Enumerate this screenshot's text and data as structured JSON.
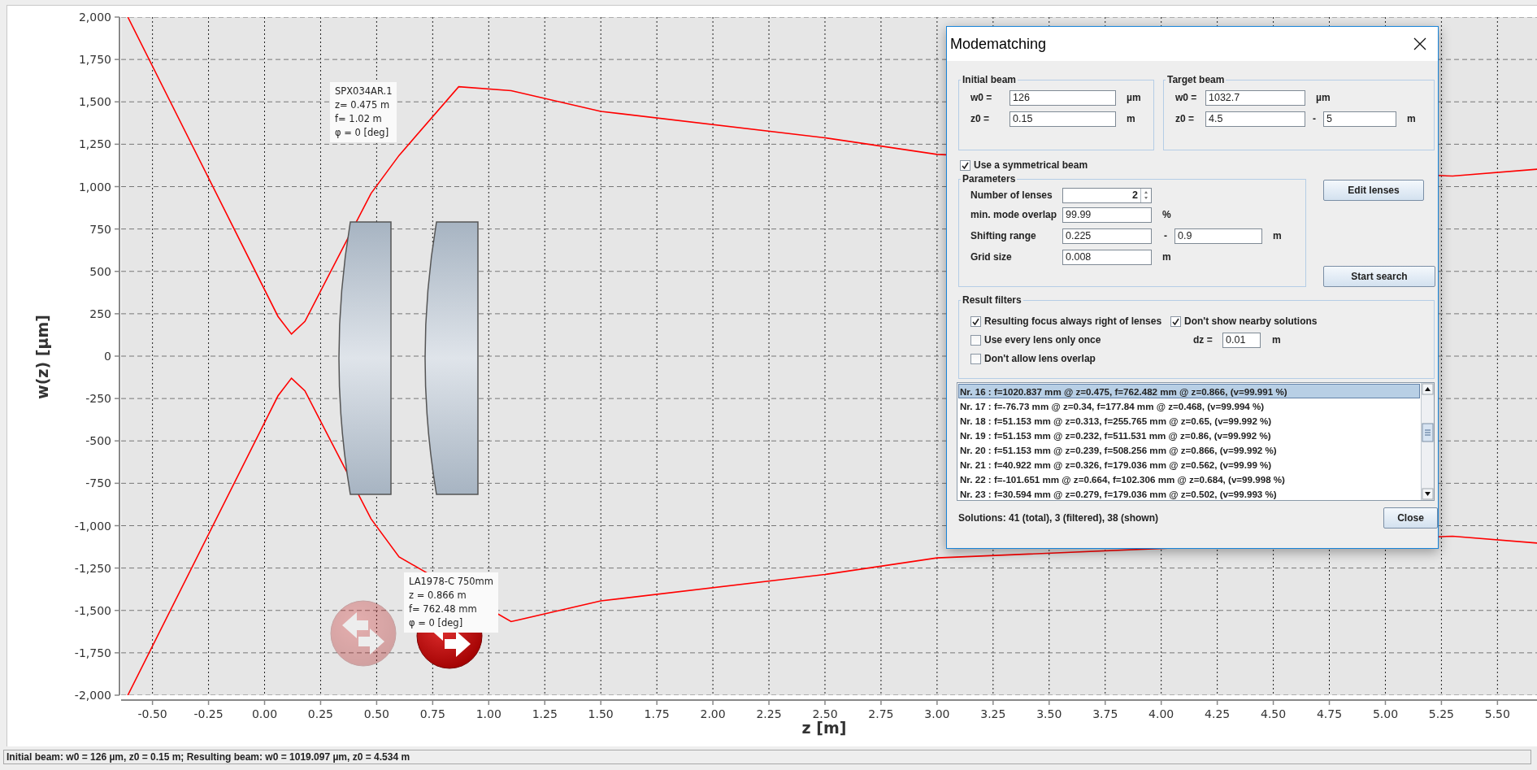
{
  "chart": {
    "chart_data": {
      "type": "line",
      "xlabel": "z [m]",
      "ylabel": "w(z) [µm]",
      "x": [
        -0.61,
        0.06,
        0.12,
        0.18,
        0.475,
        0.6,
        0.866,
        1.1,
        1.5,
        2.5,
        3.0,
        5.3,
        5.68
      ],
      "series": [
        {
          "color": "#ff0000",
          "values": [
            2000,
            234,
            130,
            205,
            960,
            1184,
            1589,
            1566,
            1444,
            1288,
            1190,
            1062,
            1103
          ]
        },
        {
          "color": "#ff0000",
          "values": [
            -2000,
            -234,
            -130,
            -205,
            -960,
            -1184,
            null,
            -1566,
            -1444,
            -1288,
            -1190,
            -1062,
            -1103
          ]
        }
      ],
      "grid": true,
      "xlim": [
        -0.64,
        5.68
      ],
      "ylim": [
        -2000,
        2000
      ],
      "xticks": [
        {
          "value": -0.5,
          "label": "-0.50"
        },
        {
          "value": -0.25,
          "label": "-0.25"
        },
        {
          "value": 0,
          "label": "0.00"
        },
        {
          "value": 0.25,
          "label": "0.25"
        },
        {
          "value": 0.5,
          "label": "0.50"
        },
        {
          "value": 0.75,
          "label": "0.75"
        },
        {
          "value": 1,
          "label": "1.00"
        },
        {
          "value": 1.25,
          "label": "1.25"
        },
        {
          "value": 1.5,
          "label": "1.50"
        },
        {
          "value": 1.75,
          "label": "1.75"
        },
        {
          "value": 2,
          "label": "2.00"
        },
        {
          "value": 2.25,
          "label": "2.25"
        },
        {
          "value": 2.5,
          "label": "2.50"
        },
        {
          "value": 2.75,
          "label": "2.75"
        },
        {
          "value": 3,
          "label": "3.00"
        },
        {
          "value": 3.25,
          "label": "3.25"
        },
        {
          "value": 3.5,
          "label": "3.50"
        },
        {
          "value": 3.75,
          "label": "3.75"
        },
        {
          "value": 4,
          "label": "4.00"
        },
        {
          "value": 4.25,
          "label": "4.25"
        },
        {
          "value": 4.5,
          "label": "4.50"
        },
        {
          "value": 4.75,
          "label": "4.75"
        },
        {
          "value": 5,
          "label": "5.00"
        },
        {
          "value": 5.25,
          "label": "5.25"
        },
        {
          "value": 5.5,
          "label": "5.50"
        }
      ],
      "yticks": [
        {
          "value": 2000,
          "label": "2,000"
        },
        {
          "value": 1750,
          "label": "1,750"
        },
        {
          "value": 1500,
          "label": "1,500"
        },
        {
          "value": 1250,
          "label": "1,250"
        },
        {
          "value": 1000,
          "label": "1,000"
        },
        {
          "value": 750,
          "label": "750"
        },
        {
          "value": 500,
          "label": "500"
        },
        {
          "value": 250,
          "label": "250"
        },
        {
          "value": 0,
          "label": "0"
        },
        {
          "value": -250,
          "label": "-250"
        },
        {
          "value": -500,
          "label": "-500"
        },
        {
          "value": -750,
          "label": "-750"
        },
        {
          "value": -1000,
          "label": "-1,000"
        },
        {
          "value": -1250,
          "label": "-1,250"
        },
        {
          "value": -1500,
          "label": "-1,500"
        },
        {
          "value": -1750,
          "label": "-1,750"
        },
        {
          "value": -2000,
          "label": "-2,000"
        }
      ]
    },
    "lenses": [
      {
        "lines": [
          "SPX034AR.1",
          "z= 0.475 m",
          "f= 1.02 m",
          "φ = 0 [deg]"
        ]
      },
      {
        "lines": [
          "LA1978-C 750mm",
          "z = 0.866 m",
          "f= 762.48 mm",
          "φ = 0 [deg]"
        ]
      }
    ],
    "shift_buttons": [
      {
        "disabled": true
      },
      {
        "disabled": false
      }
    ]
  },
  "dialog": {
    "title": "Modematching",
    "initial_beam": {
      "title": "Initial beam",
      "rows": [
        {
          "label": "w0 =",
          "value": "126",
          "unit": "µm"
        },
        {
          "label": "z0 =",
          "value": "0.15",
          "unit": "m"
        }
      ]
    },
    "target_beam": {
      "title": "Target beam",
      "rows": [
        {
          "label": "w0 =",
          "value": "1032.7",
          "unit": "µm"
        },
        {
          "label": "z0 =",
          "value": "4.5",
          "separator": "-",
          "value2": "5",
          "unit": "m"
        }
      ]
    },
    "symmetric": {
      "label": "Use a symmetrical beam",
      "checked": true
    },
    "parameters": {
      "title": "Parameters",
      "rows": [
        {
          "kind": "spinner",
          "label": "Number of lenses",
          "value": "2"
        },
        {
          "kind": "field",
          "label": "min. mode overlap",
          "value": "99.99",
          "unit": "%"
        },
        {
          "kind": "range",
          "label": "Shifting range",
          "value": "0.225",
          "separator": "-",
          "value2": "0.9",
          "unit": "m"
        },
        {
          "kind": "field",
          "label": "Grid size",
          "value": "0.008",
          "unit": "m"
        }
      ]
    },
    "edit_button": "Edit lenses",
    "search_button": "Start search",
    "filters": {
      "title": "Result filters",
      "checks": [
        {
          "label": "Resulting focus always right of lenses",
          "checked": true
        },
        {
          "label": "Don't show nearby solutions",
          "checked": true
        },
        {
          "label": "Use every lens only once",
          "checked": false
        },
        {
          "label": "Don't allow lens overlap",
          "checked": false
        }
      ],
      "dz": {
        "label": "dz =",
        "value": "0.01",
        "unit": "m"
      }
    },
    "results": [
      {
        "text": "Nr. 16 : f=1020.837 mm @ z=0.475, f=762.482 mm @ z=0.866,  (v=99.991 %)",
        "selected": true
      },
      {
        "text": "Nr. 17 : f=-76.73 mm @ z=0.34, f=177.84 mm @ z=0.468,  (v=99.994 %)",
        "selected": false
      },
      {
        "text": "Nr. 18 : f=51.153 mm @ z=0.313, f=255.765 mm @ z=0.65,  (v=99.992 %)",
        "selected": false
      },
      {
        "text": "Nr. 19 : f=51.153 mm @ z=0.232, f=511.531 mm @ z=0.86,  (v=99.992 %)",
        "selected": false
      },
      {
        "text": "Nr. 20 : f=51.153 mm @ z=0.239, f=508.256 mm @ z=0.866,  (v=99.992 %)",
        "selected": false
      },
      {
        "text": "Nr. 21 : f=40.922 mm @ z=0.326, f=179.036 mm @ z=0.562,  (v=99.99 %)",
        "selected": false
      },
      {
        "text": "Nr. 22 : f=-101.651 mm @ z=0.664, f=102.306 mm @ z=0.684,  (v=99.998 %)",
        "selected": false
      },
      {
        "text": "Nr. 23 : f=30.594 mm @ z=0.279, f=179.036 mm @ z=0.502,  (v=99.993 %)",
        "selected": false
      }
    ],
    "summary": "Solutions: 41 (total), 3 (filtered), 38 (shown)",
    "close_button": "Close"
  },
  "status_bar": "Initial beam: w0 = 126 µm, z0 = 0.15 m; Resulting beam: w0 = 1019.097 µm, z0 = 4.534 m"
}
